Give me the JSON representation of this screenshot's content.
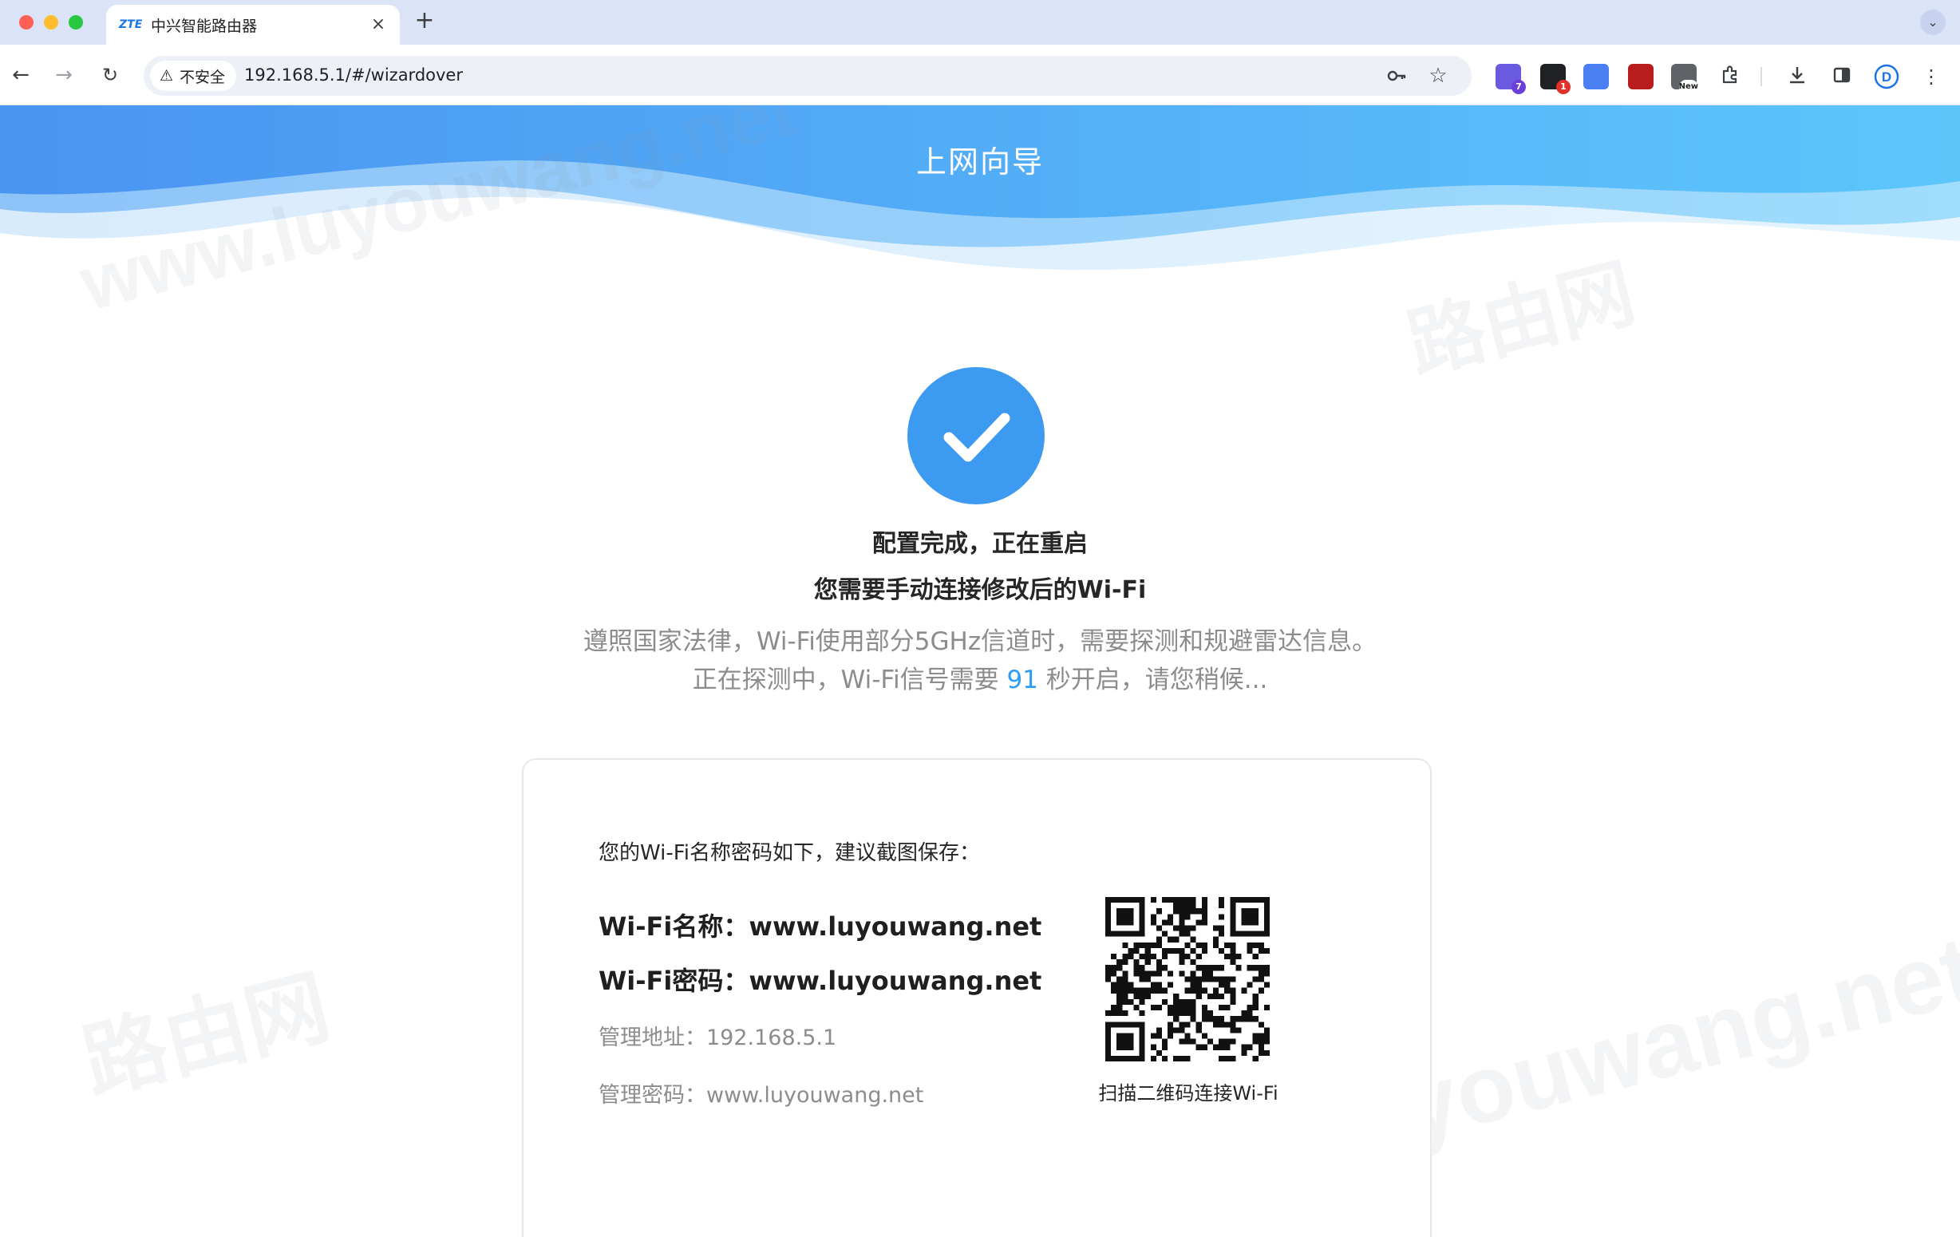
{
  "browser": {
    "tab": {
      "favicon_text": "ZTE",
      "title": "中兴智能路由器",
      "close_glyph": "×"
    },
    "new_tab_glyph": "+",
    "address_bar": {
      "security_label": "不安全",
      "url": "192.168.5.1/#/wizardover"
    },
    "extensions": [
      {
        "name": "extension-1",
        "badge": "7",
        "color": "#6a5ae0",
        "badge_color": "#6a3fd8"
      },
      {
        "name": "extension-2",
        "badge": "1",
        "color": "#202124",
        "badge_color": "#e0312b"
      },
      {
        "name": "translate-extension",
        "badge": "",
        "color": "#4a7ff0",
        "badge_color": ""
      },
      {
        "name": "ublock-extension",
        "badge": "",
        "color": "#b81d1d",
        "badge_color": ""
      },
      {
        "name": "new-extension",
        "badge": "New",
        "color": "#5f6368",
        "badge_color": ""
      }
    ],
    "profile_letter": "D"
  },
  "page": {
    "banner_title": "上网向导",
    "watermark_text": "www.luyouwang.net",
    "watermark_logo_text": "路由网",
    "status_title": "配置完成，正在重启",
    "status_subtitle": "您需要手动连接修改后的Wi-Fi",
    "notice_line1": "遵照国家法律，Wi-Fi使用部分5GHz信道时，需要探测和规避雷达信息。",
    "notice_line2_prefix": "正在探测中，Wi-Fi信号需要",
    "countdown_seconds": "91",
    "notice_line2_suffix": "秒开启，请您稍候...",
    "card": {
      "intro": "您的Wi-Fi名称密码如下，建议截图保存：",
      "wifi_name_label": "Wi-Fi名称：",
      "wifi_name_value": "www.luyouwang.net",
      "wifi_password_label": "Wi-Fi密码：",
      "wifi_password_value": "www.luyouwang.net",
      "admin_address_label": "管理地址：",
      "admin_address_value": "192.168.5.1",
      "admin_password_label": "管理密码：",
      "admin_password_value": "www.luyouwang.net",
      "qr_caption": "扫描二维码连接Wi-Fi"
    }
  },
  "colors": {
    "accent_blue": "#3c9af0",
    "countdown_blue": "#2d9cf5",
    "banner_start": "#4a94f2",
    "banner_end": "#5cc6fb"
  }
}
